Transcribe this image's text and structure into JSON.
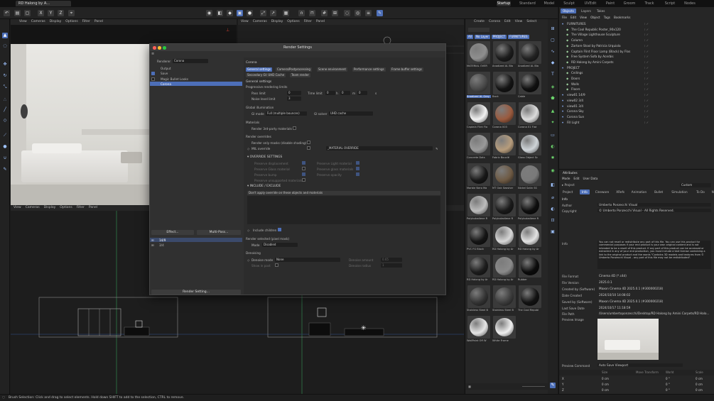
{
  "tabbar": {
    "doc_tab": "RD Halong by A... Carpets.c4d *",
    "layouts": [
      "Startup",
      "Standard",
      "Model",
      "Sculpt",
      "UVEdit",
      "Paint",
      "Groom",
      "Track",
      "Script",
      "Nodes"
    ],
    "active_layout": "Startup"
  },
  "toolbar": {
    "coords": [
      "X",
      "Y",
      "Z"
    ]
  },
  "viewports": {
    "top_left_menu": [
      "View",
      "Cameras",
      "Display",
      "Options",
      "Filter",
      "Panel"
    ],
    "top_right_menu": [
      "View",
      "Cameras",
      "Display",
      "Options",
      "Filter",
      "Panel"
    ],
    "bottom_left_menu": [
      "View",
      "Cameras",
      "Display",
      "Options",
      "Filter",
      "Panel"
    ]
  },
  "render_settings": {
    "title": "Render Settings",
    "renderer_label": "Renderer",
    "renderer_value": "Corona",
    "left_items": [
      "Output",
      "Save",
      "Magic Bullet Looks",
      "Corona"
    ],
    "effect_button": "Effect...",
    "multipass_button": "Multi-Pass...",
    "presets": [
      "14/9",
      "3/4"
    ],
    "render_setting_button": "Render Setting...",
    "section_title": "Corona",
    "tabs_row1": [
      "General settings",
      "Camera/Postprocessing",
      "Scene environment",
      "Performance settings",
      "Frame buffer settings"
    ],
    "tabs_row2": [
      "Secondary GI: UHD Cache",
      "Team render"
    ],
    "general_heading": "General settings",
    "progressive_heading": "Progressive rendering limits",
    "pass_limit_label": "Pass limit",
    "pass_limit_value": "0",
    "time_limit_label": "Time limit",
    "time_h": "0",
    "time_h_unit": "h",
    "time_m": "0",
    "time_m_unit": "m",
    "time_s": "0",
    "time_s_unit": "s",
    "noise_label": "Noise level limit",
    "noise_value": "3",
    "gi_heading": "Global illumination",
    "gi_mode_label": "GI mode",
    "gi_mode_value": "Full (multiple bounces)",
    "gi_solver_label": "GI solver",
    "gi_solver_value": "UHD cache",
    "materials_heading": "Materials",
    "render_3rd_party": "Render 3rd-party materials",
    "overrides_heading": "Render overrides",
    "render_masks": "Render only masks (disable shading)",
    "mtl_override_label": "MtL override",
    "mtl_override_value": "_MATERIAL OVERRIDE",
    "override_settings": "OVERRIDE SETTINGS",
    "preserve_left": [
      "Preserve displacement",
      "Preserve Glass material",
      "Preserve bump",
      "Preserve unsupported materials"
    ],
    "preserve_right": [
      "Preserve Light material",
      "Preserve glass materials",
      "Preserve opacity"
    ],
    "include_exclude": "INCLUDE / EXCLUDE",
    "include_mode": "Don't apply override on these objects and materials",
    "include_children": "Include children",
    "render_selected": "Render selected (pixel mask)",
    "mode_label": "Mode",
    "mode_value": "Disabled",
    "denoising_heading": "Denoising",
    "denoise_mode_label": "Denoise mode",
    "denoise_mode_value": "None",
    "denoise_amount_label": "Denoise amount",
    "denoise_amount_value": "0.65",
    "show_in_post": "Show in post",
    "denoise_radius_label": "Denoise radius",
    "denoise_radius_value": "1"
  },
  "material_manager": {
    "menu": [
      "Create",
      "Corona",
      "Edit",
      "View",
      "Select"
    ],
    "filters": [
      "All",
      "No Layer",
      "PROJECT",
      "FURNITURES"
    ],
    "materials": [
      {
        "name": "MATERIAL OVER",
        "color": "#8f8f8f"
      },
      {
        "name": "Anodized AL Bla",
        "color": "#1c1c1c"
      },
      {
        "name": "Anodized AL Bla",
        "color": "#222222"
      },
      {
        "name": "Anodized AL Grey",
        "color": "#4a4a4a"
      },
      {
        "name": "Back",
        "color": "#141414"
      },
      {
        "name": "Cable",
        "color": "#101010"
      },
      {
        "name": "Captain Flint Flo",
        "color": "#f2f2f2"
      },
      {
        "name": "Corona 003",
        "color": "#9a5a3e"
      },
      {
        "name": "Corona 01 Flat",
        "color": "#dcdcdc"
      },
      {
        "name": "Concrete Dots",
        "color": "#9a9a9a"
      },
      {
        "name": "Fabric Bouclé",
        "color": "#b69c7c"
      },
      {
        "name": "Glass Object Sc",
        "color": "#cfd4d8"
      },
      {
        "name": "Marble Nero Ma",
        "color": "#181818"
      },
      {
        "name": "MT Oak Seasher",
        "color": "#6e5a44"
      },
      {
        "name": "Nickel Satin SS",
        "color": "#7a7a7a"
      },
      {
        "name": "Polybutadiene R",
        "color": "#bcbcbc"
      },
      {
        "name": "Polybutadiene R",
        "color": "#1a1a1a"
      },
      {
        "name": "Polybutadiene R",
        "color": "#0e0e0e"
      },
      {
        "name": "PVC FG Black",
        "color": "#151515"
      },
      {
        "name": "RD Halong by Ar",
        "color": "#d7d7d7"
      },
      {
        "name": "RD Halong by Ar",
        "color": "#e2e2e2"
      },
      {
        "name": "RD Halong by Ar",
        "color": "#1d1d1d"
      },
      {
        "name": "RD Halong by Ar",
        "color": "#8a8a8a"
      },
      {
        "name": "Rubber",
        "color": "#0c0c0c"
      },
      {
        "name": "Stainless Steel B",
        "color": "#333333"
      },
      {
        "name": "Stainless Steel B",
        "color": "#3c3c3c"
      },
      {
        "name": "The Cool Republ",
        "color": "#121212"
      },
      {
        "name": "WallPaint Off W",
        "color": "#e6e6e6"
      },
      {
        "name": "White Frame",
        "color": "#f0f0f0"
      }
    ]
  },
  "objects_panel": {
    "tabs": [
      "Objects",
      "Layers",
      "Takes"
    ],
    "menu": [
      "File",
      "Edit",
      "View",
      "Object",
      "Tags",
      "Bookmarks"
    ],
    "items": [
      {
        "name": "FURNITURES",
        "indent": 0
      },
      {
        "name": "The Cool Republic Poster_90x120",
        "indent": 1
      },
      {
        "name": "The Village Lighthouse Sculpture",
        "indent": 1
      },
      {
        "name": "Column",
        "indent": 1
      },
      {
        "name": "Zartore Stool by Patricia Urquiola",
        "indent": 1
      },
      {
        "name": "Captain Flint Floor Lamp (Black) by Flos",
        "indent": 1
      },
      {
        "name": "Free System Sofa by Acerbis",
        "indent": 1
      },
      {
        "name": "RD Halong by Amini Carpets",
        "indent": 1
      },
      {
        "name": "PROJECT",
        "indent": 0
      },
      {
        "name": "Ceilings",
        "indent": 1
      },
      {
        "name": "Doors",
        "indent": 1
      },
      {
        "name": "Walls",
        "indent": 1
      },
      {
        "name": "Floors",
        "indent": 1
      },
      {
        "name": "view01 14/9",
        "indent": 0
      },
      {
        "name": "view02 3/4",
        "indent": 0
      },
      {
        "name": "view01 3/4",
        "indent": 0
      },
      {
        "name": "Corona Sky",
        "indent": 0
      },
      {
        "name": "Corona Sun",
        "indent": 0
      },
      {
        "name": "Fill Light",
        "indent": 0
      }
    ]
  },
  "attributes": {
    "title": "Attributes",
    "menu": [
      "Mode",
      "Edit",
      "User Data"
    ],
    "object": "Project",
    "preset": "Custom",
    "tabs": [
      "Project",
      "Info",
      "Cineware",
      "XRefs",
      "Animation",
      "Bullet",
      "Simulation",
      "To Do",
      "Nodes"
    ],
    "active_tab": "Info",
    "section": "Info",
    "author_label": "Author",
    "author": "Umberto Ponzecchi Visual",
    "copyright_label": "Copyright",
    "copyright": "© Umberto Ponzecchi Visual - All Rights Reserved.",
    "info_label": "Info",
    "info_text": "You can not resell or redistribute any part of this file. You can use this product for commercial purposes if your end product is your own original content and is not intended to be a resell of this product. If any part of this product can be accessed or extracted in any of your end production, you must include a text license containing a link to the original product and the words \"Contains 3D models and textures from © Umberto Ponzecchi Visual - any part of this file may not be redistributed\".",
    "file_format_label": "File Format",
    "file_format": "Cinema 4D (*.c4d)",
    "file_version_label": "File Version",
    "file_version": "2025.0.1",
    "created_label": "Created by (Software)",
    "created": "Maxon Cinema 4D 2025.0.1 (#300000218)",
    "date_created_label": "Date Created",
    "date_created": "2024/10/10 14:08:02",
    "saved_label": "Saved by (Software)",
    "saved": "Maxon Cinema 4D 2025.0.1 (#300000218)",
    "last_saved_label": "Last Save Date",
    "last_saved": "2024/10/17 11:18:59",
    "path_label": "File Path",
    "path": "/Users/umbertoponzecchi/Desktop/RD Halong by Amini Carpets/RD Halo...",
    "preview_label": "Preview Image",
    "save_cmd_label": "Preview Command",
    "save_cmd": "Auto Save Viewport",
    "xform_header": [
      "Size",
      "Move Transform",
      "World",
      "Scale"
    ],
    "xform_rows": [
      {
        "axis": "X",
        "a": "0 cm",
        "b": "0 °",
        "c": "0 cm"
      },
      {
        "axis": "Y",
        "a": "0 cm",
        "b": "0 °",
        "c": "0 cm"
      },
      {
        "axis": "Z",
        "a": "0 cm",
        "b": "0 °",
        "c": "0 cm"
      }
    ]
  },
  "status": {
    "text": "Brush Selection: Click and drag to select elements. Hold down SHIFT to add to the selection, CTRL to remove."
  }
}
